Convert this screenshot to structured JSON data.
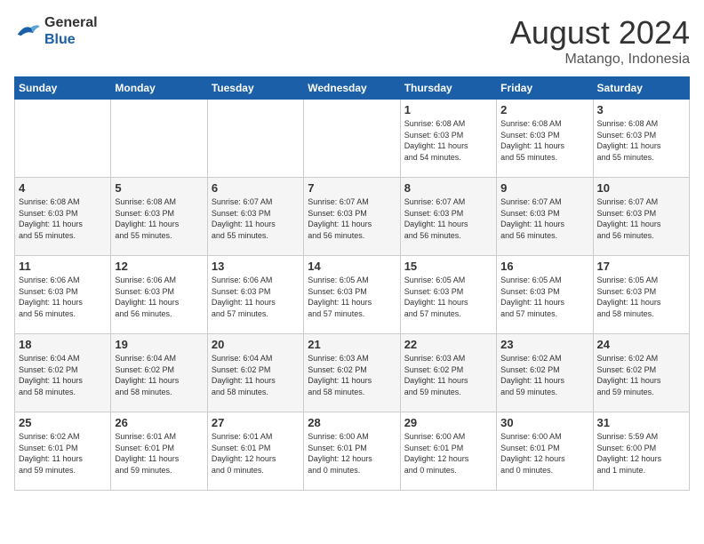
{
  "header": {
    "logo_line1": "General",
    "logo_line2": "Blue",
    "month_year": "August 2024",
    "location": "Matango, Indonesia"
  },
  "days_of_week": [
    "Sunday",
    "Monday",
    "Tuesday",
    "Wednesday",
    "Thursday",
    "Friday",
    "Saturday"
  ],
  "weeks": [
    [
      {
        "day": "",
        "info": ""
      },
      {
        "day": "",
        "info": ""
      },
      {
        "day": "",
        "info": ""
      },
      {
        "day": "",
        "info": ""
      },
      {
        "day": "1",
        "info": "Sunrise: 6:08 AM\nSunset: 6:03 PM\nDaylight: 11 hours\nand 54 minutes."
      },
      {
        "day": "2",
        "info": "Sunrise: 6:08 AM\nSunset: 6:03 PM\nDaylight: 11 hours\nand 55 minutes."
      },
      {
        "day": "3",
        "info": "Sunrise: 6:08 AM\nSunset: 6:03 PM\nDaylight: 11 hours\nand 55 minutes."
      }
    ],
    [
      {
        "day": "4",
        "info": "Sunrise: 6:08 AM\nSunset: 6:03 PM\nDaylight: 11 hours\nand 55 minutes."
      },
      {
        "day": "5",
        "info": "Sunrise: 6:08 AM\nSunset: 6:03 PM\nDaylight: 11 hours\nand 55 minutes."
      },
      {
        "day": "6",
        "info": "Sunrise: 6:07 AM\nSunset: 6:03 PM\nDaylight: 11 hours\nand 55 minutes."
      },
      {
        "day": "7",
        "info": "Sunrise: 6:07 AM\nSunset: 6:03 PM\nDaylight: 11 hours\nand 56 minutes."
      },
      {
        "day": "8",
        "info": "Sunrise: 6:07 AM\nSunset: 6:03 PM\nDaylight: 11 hours\nand 56 minutes."
      },
      {
        "day": "9",
        "info": "Sunrise: 6:07 AM\nSunset: 6:03 PM\nDaylight: 11 hours\nand 56 minutes."
      },
      {
        "day": "10",
        "info": "Sunrise: 6:07 AM\nSunset: 6:03 PM\nDaylight: 11 hours\nand 56 minutes."
      }
    ],
    [
      {
        "day": "11",
        "info": "Sunrise: 6:06 AM\nSunset: 6:03 PM\nDaylight: 11 hours\nand 56 minutes."
      },
      {
        "day": "12",
        "info": "Sunrise: 6:06 AM\nSunset: 6:03 PM\nDaylight: 11 hours\nand 56 minutes."
      },
      {
        "day": "13",
        "info": "Sunrise: 6:06 AM\nSunset: 6:03 PM\nDaylight: 11 hours\nand 57 minutes."
      },
      {
        "day": "14",
        "info": "Sunrise: 6:05 AM\nSunset: 6:03 PM\nDaylight: 11 hours\nand 57 minutes."
      },
      {
        "day": "15",
        "info": "Sunrise: 6:05 AM\nSunset: 6:03 PM\nDaylight: 11 hours\nand 57 minutes."
      },
      {
        "day": "16",
        "info": "Sunrise: 6:05 AM\nSunset: 6:03 PM\nDaylight: 11 hours\nand 57 minutes."
      },
      {
        "day": "17",
        "info": "Sunrise: 6:05 AM\nSunset: 6:03 PM\nDaylight: 11 hours\nand 58 minutes."
      }
    ],
    [
      {
        "day": "18",
        "info": "Sunrise: 6:04 AM\nSunset: 6:02 PM\nDaylight: 11 hours\nand 58 minutes."
      },
      {
        "day": "19",
        "info": "Sunrise: 6:04 AM\nSunset: 6:02 PM\nDaylight: 11 hours\nand 58 minutes."
      },
      {
        "day": "20",
        "info": "Sunrise: 6:04 AM\nSunset: 6:02 PM\nDaylight: 11 hours\nand 58 minutes."
      },
      {
        "day": "21",
        "info": "Sunrise: 6:03 AM\nSunset: 6:02 PM\nDaylight: 11 hours\nand 58 minutes."
      },
      {
        "day": "22",
        "info": "Sunrise: 6:03 AM\nSunset: 6:02 PM\nDaylight: 11 hours\nand 59 minutes."
      },
      {
        "day": "23",
        "info": "Sunrise: 6:02 AM\nSunset: 6:02 PM\nDaylight: 11 hours\nand 59 minutes."
      },
      {
        "day": "24",
        "info": "Sunrise: 6:02 AM\nSunset: 6:02 PM\nDaylight: 11 hours\nand 59 minutes."
      }
    ],
    [
      {
        "day": "25",
        "info": "Sunrise: 6:02 AM\nSunset: 6:01 PM\nDaylight: 11 hours\nand 59 minutes."
      },
      {
        "day": "26",
        "info": "Sunrise: 6:01 AM\nSunset: 6:01 PM\nDaylight: 11 hours\nand 59 minutes."
      },
      {
        "day": "27",
        "info": "Sunrise: 6:01 AM\nSunset: 6:01 PM\nDaylight: 12 hours\nand 0 minutes."
      },
      {
        "day": "28",
        "info": "Sunrise: 6:00 AM\nSunset: 6:01 PM\nDaylight: 12 hours\nand 0 minutes."
      },
      {
        "day": "29",
        "info": "Sunrise: 6:00 AM\nSunset: 6:01 PM\nDaylight: 12 hours\nand 0 minutes."
      },
      {
        "day": "30",
        "info": "Sunrise: 6:00 AM\nSunset: 6:01 PM\nDaylight: 12 hours\nand 0 minutes."
      },
      {
        "day": "31",
        "info": "Sunrise: 5:59 AM\nSunset: 6:00 PM\nDaylight: 12 hours\nand 1 minute."
      }
    ]
  ]
}
